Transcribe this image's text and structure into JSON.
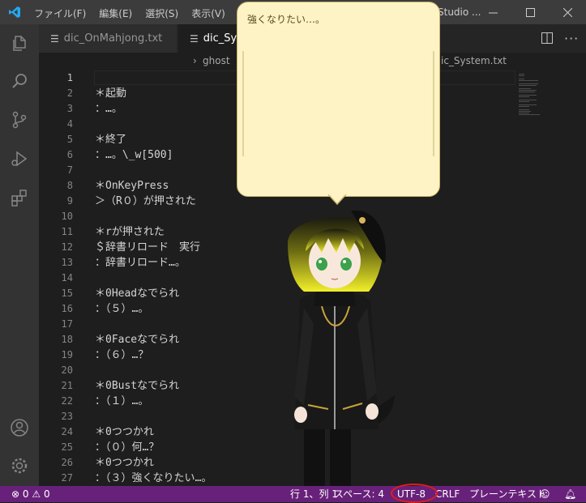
{
  "titlebar": {
    "menu": [
      "ファイル(F)",
      "編集(E)",
      "選択(S)",
      "表示(V)",
      "移"
    ],
    "title": "Studio ..."
  },
  "tabs": [
    {
      "label": "dic_OnMahjong.txt",
      "active": false
    },
    {
      "label": "dic_Syst",
      "active": true
    }
  ],
  "breadcrumb": {
    "folder": "ghost",
    "file": "ic_System.txt"
  },
  "editor": {
    "lines": [
      {
        "num": "1",
        "text": ""
      },
      {
        "num": "2",
        "text": "＊起動"
      },
      {
        "num": "3",
        "text": "：…。"
      },
      {
        "num": "4",
        "text": ""
      },
      {
        "num": "5",
        "text": "＊終了"
      },
      {
        "num": "6",
        "text": "：…。\\_w[500]"
      },
      {
        "num": "7",
        "text": ""
      },
      {
        "num": "8",
        "text": "＊OnKeyPress"
      },
      {
        "num": "9",
        "text": "＞（R０）が押された"
      },
      {
        "num": "10",
        "text": ""
      },
      {
        "num": "11",
        "text": "＊rが押された"
      },
      {
        "num": "12",
        "text": "＄辞書リロード　実行"
      },
      {
        "num": "13",
        "text": "：辞書リロード…。"
      },
      {
        "num": "14",
        "text": ""
      },
      {
        "num": "15",
        "text": "＊0Headなでられ"
      },
      {
        "num": "16",
        "text": "：（５）…。"
      },
      {
        "num": "17",
        "text": ""
      },
      {
        "num": "18",
        "text": "＊0Faceなでられ"
      },
      {
        "num": "19",
        "text": "：（６）…？"
      },
      {
        "num": "20",
        "text": ""
      },
      {
        "num": "21",
        "text": "＊0Bustなでられ"
      },
      {
        "num": "22",
        "text": "：（１）…。"
      },
      {
        "num": "23",
        "text": ""
      },
      {
        "num": "24",
        "text": "＊0つつかれ"
      },
      {
        "num": "25",
        "text": "：（０）何…？"
      },
      {
        "num": "26",
        "text": "＊0つつかれ"
      },
      {
        "num": "27",
        "text": "：（３）強くなりたい…。"
      }
    ]
  },
  "balloon": {
    "text": "強くなりたい…。"
  },
  "statusbar": {
    "errors": "0",
    "warnings": "0",
    "position": "行 1、列 1",
    "spaces": "スペース: 4",
    "encoding": "UTF-8",
    "eol": "CRLF",
    "language": "プレーンテキスト"
  },
  "colors": {
    "statusbar": "#68217a",
    "balloon": "#fdf3c4",
    "annotation_circle": "#e01c1c"
  }
}
